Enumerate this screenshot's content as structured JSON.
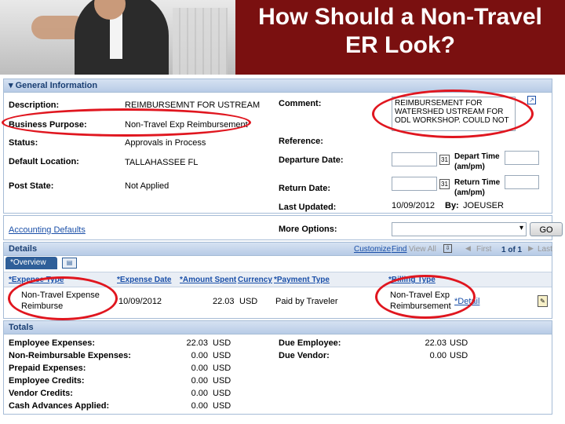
{
  "slide": {
    "title_line1": "How Should a Non-Travel",
    "title_line2": "ER Look?"
  },
  "general": {
    "section_label": "General Information",
    "description_label": "Description:",
    "description_value": "REIMBURSEMNT FOR USTREAM",
    "business_purpose_label": "Business Purpose:",
    "business_purpose_value": "Non-Travel Exp Reimbursement",
    "status_label": "Status:",
    "status_value": "Approvals in Process",
    "default_location_label": "Default Location:",
    "default_location_value": "TALLAHASSEE FL",
    "post_state_label": "Post State:",
    "post_state_value": "Not Applied",
    "comment_label": "Comment:",
    "comment_line1": "REIMBURSEMENT FOR",
    "comment_line2": "WATERSHED USTREAM FOR",
    "comment_line3": "ODL WORKSHOP. COULD NOT",
    "reference_label": "Reference:",
    "departure_date_label": "Departure Date:",
    "depart_time_label": "Depart Time",
    "depart_time_unit": "(am/pm)",
    "return_date_label": "Return Date:",
    "return_time_label": "Return Time",
    "return_time_unit": "(am/pm)",
    "last_updated_label": "Last Updated:",
    "last_updated_value": "10/09/2012",
    "by_label": "By:",
    "by_value": "JOEUSER",
    "calendar_glyph": "31"
  },
  "actions": {
    "accounting_defaults": "Accounting Defaults",
    "more_options_label": "More Options:",
    "go_button": "GO"
  },
  "details": {
    "section_label": "Details",
    "customize": "Customize",
    "find": "Find",
    "view_all": "View All",
    "first": "First",
    "pager": "1 of 1",
    "last": "Last",
    "tab_overview": "*Overview",
    "columns": [
      "*Expense Type",
      "*Expense Date",
      "*Amount Spent",
      "Currency",
      "*Payment Type",
      "*Billing Type"
    ],
    "row": {
      "expense_type_line1": "Non-Travel Expense",
      "expense_type_line2": "Reimburse",
      "expense_date": "10/09/2012",
      "amount": "22.03",
      "currency": "USD",
      "payment_type": "Paid by Traveler",
      "billing_type_line1": "Non-Travel Exp",
      "billing_type_line2": "Reimbursement",
      "detail_link": "*Detail"
    }
  },
  "totals": {
    "section_label": "Totals",
    "left": [
      {
        "label": "Employee Expenses:",
        "amount": "22.03",
        "currency": "USD"
      },
      {
        "label": "Non-Reimbursable Expenses:",
        "amount": "0.00",
        "currency": "USD"
      },
      {
        "label": "Prepaid Expenses:",
        "amount": "0.00",
        "currency": "USD"
      },
      {
        "label": "Employee Credits:",
        "amount": "0.00",
        "currency": "USD"
      },
      {
        "label": "Vendor Credits:",
        "amount": "0.00",
        "currency": "USD"
      },
      {
        "label": "Cash Advances Applied:",
        "amount": "0.00",
        "currency": "USD"
      }
    ],
    "right": [
      {
        "label": "Due Employee:",
        "amount": "22.03",
        "currency": "USD"
      },
      {
        "label": "Due Vendor:",
        "amount": "0.00",
        "currency": "USD"
      }
    ]
  },
  "colors": {
    "header_bg": "#7a1010",
    "highlight": "#e0161f",
    "link": "#1a4fa8",
    "panel_bar": "#b7cbe6"
  }
}
